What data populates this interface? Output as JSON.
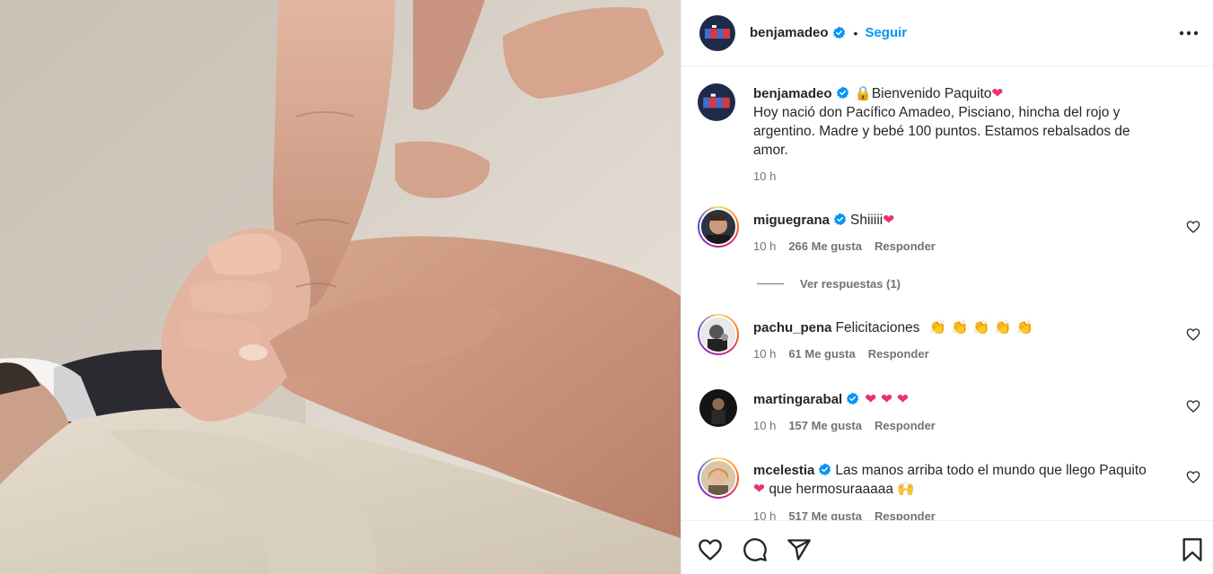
{
  "post": {
    "author": "benjamadeo",
    "follow_label": "Seguir",
    "separator": "•",
    "caption_emoji": "🔒",
    "caption_title": "Bienvenido Paquito",
    "caption_heart": "❤",
    "caption_text": "Hoy nació don Pacífico Amadeo, Pisciano, hincha del rojo y argentino. Madre y bebé 100 puntos. Estamos rebalsados de amor.",
    "caption_time": "10 h"
  },
  "comments": [
    {
      "user": "miguegrana",
      "text": "Shiiiii",
      "emoji": "❤",
      "time": "10 h",
      "likes": "266 Me gusta",
      "reply": "Responder"
    },
    {
      "user": "pachu_pena",
      "text": "Felicitaciones",
      "emoji": "👏 👏  👏 👏 👏",
      "time": "10 h",
      "likes": "61 Me gusta",
      "reply": "Responder"
    },
    {
      "user": "martingarabal",
      "text": "",
      "emoji": "❤ ❤ ❤",
      "time": "10 h",
      "likes": "157 Me gusta",
      "reply": "Responder"
    },
    {
      "user": "mcelestia",
      "text": "Las manos arriba todo el mundo que llego Paquito",
      "emoji": "❤",
      "text2": "que hermosuraaaaa",
      "emoji2": "🙌",
      "time": "10 h",
      "likes": "517 Me gusta",
      "reply": "Responder"
    }
  ],
  "view_replies": "Ver respuestas (1)",
  "icons": {
    "like": "heart-icon",
    "comment": "comment-icon",
    "share": "share-icon",
    "save": "bookmark-icon",
    "more": "more-options-icon",
    "verified": "verified-badge-icon"
  },
  "colors": {
    "accent": "#0095f6",
    "verified": "#0095f6",
    "heart": "#e8336b",
    "muted": "#737373"
  }
}
